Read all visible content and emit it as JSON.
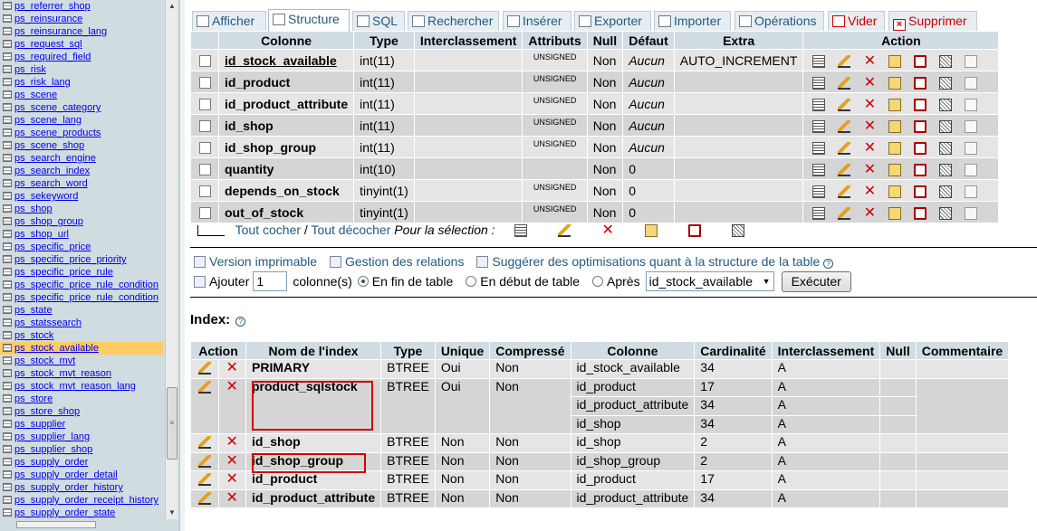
{
  "sidebar": {
    "tables": [
      "ps_referrer_shop",
      "ps_reinsurance",
      "ps_reinsurance_lang",
      "ps_request_sql",
      "ps_required_field",
      "ps_risk",
      "ps_risk_lang",
      "ps_scene",
      "ps_scene_category",
      "ps_scene_lang",
      "ps_scene_products",
      "ps_scene_shop",
      "ps_search_engine",
      "ps_search_index",
      "ps_search_word",
      "ps_sekeyword",
      "ps_shop",
      "ps_shop_group",
      "ps_shop_url",
      "ps_specific_price",
      "ps_specific_price_priority",
      "ps_specific_price_rule",
      "ps_specific_price_rule_condition",
      "ps_specific_price_rule_condition",
      "ps_state",
      "ps_statssearch",
      "ps_stock",
      "ps_stock_available",
      "ps_stock_mvt",
      "ps_stock_mvt_reason",
      "ps_stock_mvt_reason_lang",
      "ps_store",
      "ps_store_shop",
      "ps_supplier",
      "ps_supplier_lang",
      "ps_supplier_shop",
      "ps_supply_order",
      "ps_supply_order_detail",
      "ps_supply_order_history",
      "ps_supply_order_receipt_history",
      "ps_supply_order_state"
    ],
    "active": "ps_stock_available"
  },
  "tabs": [
    {
      "label": "Afficher",
      "icon": "browse-icon",
      "active": false
    },
    {
      "label": "Structure",
      "icon": "structure-icon",
      "active": true
    },
    {
      "label": "SQL",
      "icon": "sql-icon",
      "active": false
    },
    {
      "label": "Rechercher",
      "icon": "search-icon",
      "active": false
    },
    {
      "label": "Insérer",
      "icon": "insert-icon",
      "active": false
    },
    {
      "label": "Exporter",
      "icon": "export-icon",
      "active": false
    },
    {
      "label": "Importer",
      "icon": "import-icon",
      "active": false
    },
    {
      "label": "Opérations",
      "icon": "tools-icon",
      "active": false
    },
    {
      "label": "Vider",
      "icon": "empty-icon",
      "active": false
    },
    {
      "label": "Supprimer",
      "icon": "drop-icon",
      "active": false
    }
  ],
  "structure": {
    "headers": {
      "column": "Colonne",
      "type": "Type",
      "collation": "Interclassement",
      "attributes": "Attributs",
      "null": "Null",
      "default": "Défaut",
      "extra": "Extra",
      "action": "Action"
    },
    "rows": [
      {
        "name": "id_stock_available",
        "type": "int(11)",
        "attr": "UNSIGNED",
        "null": "Non",
        "default": "Aucun",
        "extra": "AUTO_INCREMENT"
      },
      {
        "name": "id_product",
        "type": "int(11)",
        "attr": "UNSIGNED",
        "null": "Non",
        "default": "Aucun",
        "extra": ""
      },
      {
        "name": "id_product_attribute",
        "type": "int(11)",
        "attr": "UNSIGNED",
        "null": "Non",
        "default": "Aucun",
        "extra": ""
      },
      {
        "name": "id_shop",
        "type": "int(11)",
        "attr": "UNSIGNED",
        "null": "Non",
        "default": "Aucun",
        "extra": ""
      },
      {
        "name": "id_shop_group",
        "type": "int(11)",
        "attr": "UNSIGNED",
        "null": "Non",
        "default": "Aucun",
        "extra": ""
      },
      {
        "name": "quantity",
        "type": "int(10)",
        "attr": "",
        "null": "Non",
        "default": "0",
        "extra": ""
      },
      {
        "name": "depends_on_stock",
        "type": "tinyint(1)",
        "attr": "UNSIGNED",
        "null": "Non",
        "default": "0",
        "extra": ""
      },
      {
        "name": "out_of_stock",
        "type": "tinyint(1)",
        "attr": "UNSIGNED",
        "null": "Non",
        "default": "0",
        "extra": ""
      }
    ]
  },
  "selection": {
    "check_all": "Tout cocher",
    "separator": " / ",
    "uncheck_all": "Tout décocher",
    "for_selection": "Pour la sélection :"
  },
  "links": {
    "print": "Version imprimable",
    "relations": "Gestion des relations",
    "optimize": "Suggérer des optimisations quant à la structure de la table"
  },
  "add_columns": {
    "label": "Ajouter",
    "count": "1",
    "suffix": "colonne(s)",
    "opt_end": "En fin de table",
    "opt_start": "En début de table",
    "opt_after": "Après",
    "after_value": "id_stock_available",
    "submit": "Exécuter"
  },
  "indexes": {
    "title": "Index:",
    "headers": {
      "action": "Action",
      "name": "Nom de l'index",
      "type": "Type",
      "unique": "Unique",
      "packed": "Compressé",
      "column": "Colonne",
      "cardinality": "Cardinalité",
      "collation": "Interclassement",
      "null": "Null",
      "comment": "Commentaire"
    },
    "rows": [
      {
        "name": "PRIMARY",
        "type": "BTREE",
        "unique": "Oui",
        "packed": "Non",
        "columns": [
          {
            "col": "id_stock_available",
            "card": "34",
            "coll": "A"
          }
        ]
      },
      {
        "name": "product_sqlstock",
        "type": "BTREE",
        "unique": "Oui",
        "packed": "Non",
        "columns": [
          {
            "col": "id_product",
            "card": "17",
            "coll": "A"
          },
          {
            "col": "id_product_attribute",
            "card": "34",
            "coll": "A"
          },
          {
            "col": "id_shop",
            "card": "34",
            "coll": "A"
          }
        ]
      },
      {
        "name": "id_shop",
        "type": "BTREE",
        "unique": "Non",
        "packed": "Non",
        "columns": [
          {
            "col": "id_shop",
            "card": "2",
            "coll": "A"
          }
        ]
      },
      {
        "name": "id_shop_group",
        "type": "BTREE",
        "unique": "Non",
        "packed": "Non",
        "columns": [
          {
            "col": "id_shop_group",
            "card": "2",
            "coll": "A"
          }
        ]
      },
      {
        "name": "id_product",
        "type": "BTREE",
        "unique": "Non",
        "packed": "Non",
        "columns": [
          {
            "col": "id_product",
            "card": "17",
            "coll": "A"
          }
        ]
      },
      {
        "name": "id_product_attribute",
        "type": "BTREE",
        "unique": "Non",
        "packed": "Non",
        "columns": [
          {
            "col": "id_product_attribute",
            "card": "34",
            "coll": "A"
          }
        ]
      }
    ]
  },
  "colors": {
    "header_bg": "#d2dce3",
    "link": "#235a81",
    "highlight": "#d00000",
    "active_table": "#ffcc66"
  }
}
